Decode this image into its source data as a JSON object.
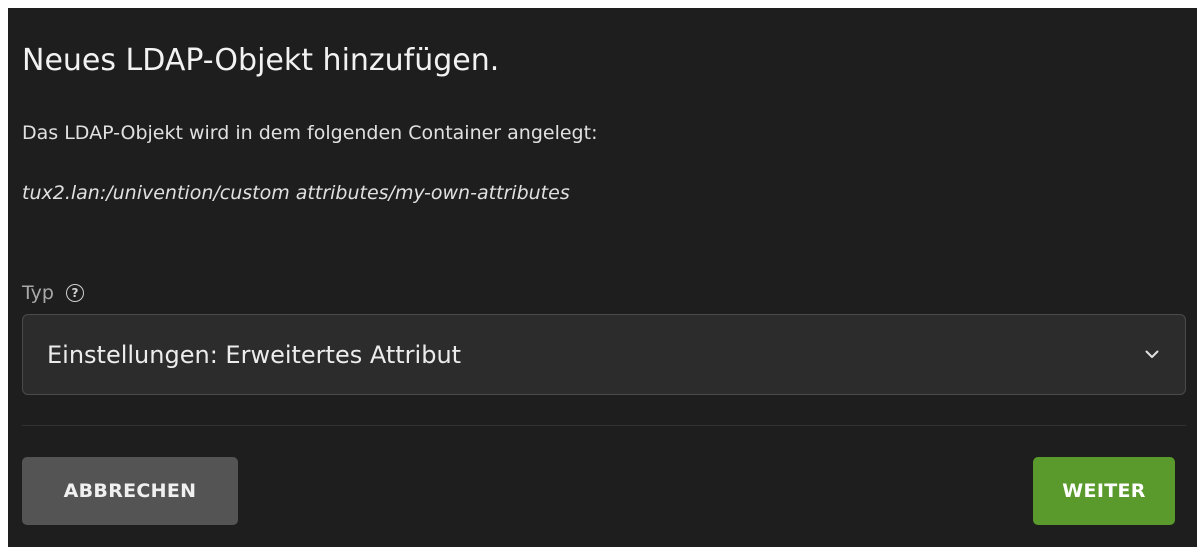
{
  "dialog": {
    "title": "Neues LDAP-Objekt hinzufügen.",
    "description": "Das LDAP-Objekt wird in dem folgenden Container angelegt:",
    "container_path": "tux2.lan:/univention/custom attributes/my-own-attributes",
    "type_field": {
      "label": "Typ",
      "help_icon": "?",
      "selected_value": "Einstellungen: Erweitertes Attribut",
      "dropdown_icon": "chevron-down-icon"
    },
    "buttons": {
      "cancel_label": "ABBRECHEN",
      "next_label": "WEITER"
    },
    "colors": {
      "background": "#1e1e1e",
      "select_background": "#2c2c2c",
      "cancel_button": "#545454",
      "next_button": "#5a9a2c"
    }
  }
}
